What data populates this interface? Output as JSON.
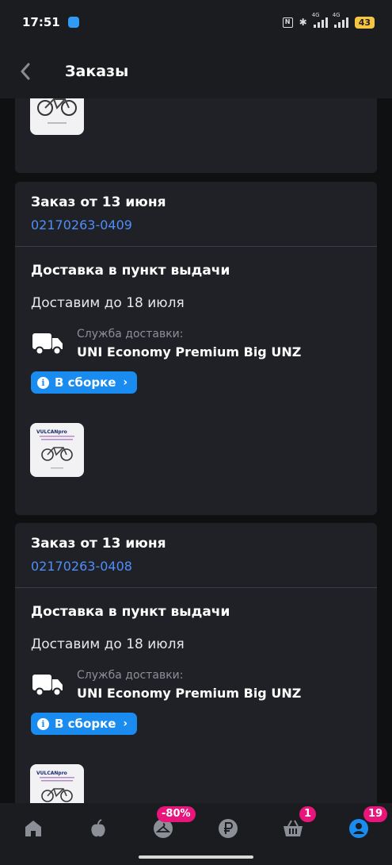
{
  "status_bar": {
    "time": "17:51",
    "network_1": "4G",
    "network_2": "4G",
    "battery": "43"
  },
  "header": {
    "title": "Заказы"
  },
  "orders": [
    {
      "title": "Заказ от 13 июня",
      "number": "02170263-0409",
      "delivery_title": "Доставка в пункт выдачи",
      "delivery_date": "Доставим до 18 июля",
      "service_label": "Служба доставки:",
      "service_name": "UNI Economy Premium Big UNZ",
      "status_label": "В сборке",
      "thumb_brand": "VULCANpro"
    },
    {
      "title": "Заказ от 13 июня",
      "number": "02170263-0408",
      "delivery_title": "Доставка в пункт выдачи",
      "delivery_date": "Доставим до 18 июля",
      "service_label": "Служба доставки:",
      "service_name": "UNI Economy Premium Big UNZ",
      "status_label": "В сборке",
      "thumb_brand": "VULCANpro"
    }
  ],
  "bottom_nav": {
    "items": [
      {
        "icon": "home-icon",
        "active": false
      },
      {
        "icon": "catalog-fruit-icon",
        "active": false
      },
      {
        "icon": "hanger-icon",
        "active": false,
        "badge": "-80%"
      },
      {
        "icon": "ruble-icon",
        "active": false
      },
      {
        "icon": "basket-icon",
        "active": false,
        "badge": "1"
      },
      {
        "icon": "profile-icon",
        "active": true,
        "badge": "19"
      }
    ]
  },
  "colors": {
    "background": "#0f1012",
    "card": "#1f2126",
    "accent_blue": "#1a8cf0",
    "link_blue": "#4f8ef7",
    "badge_pink": "#e8157a"
  }
}
